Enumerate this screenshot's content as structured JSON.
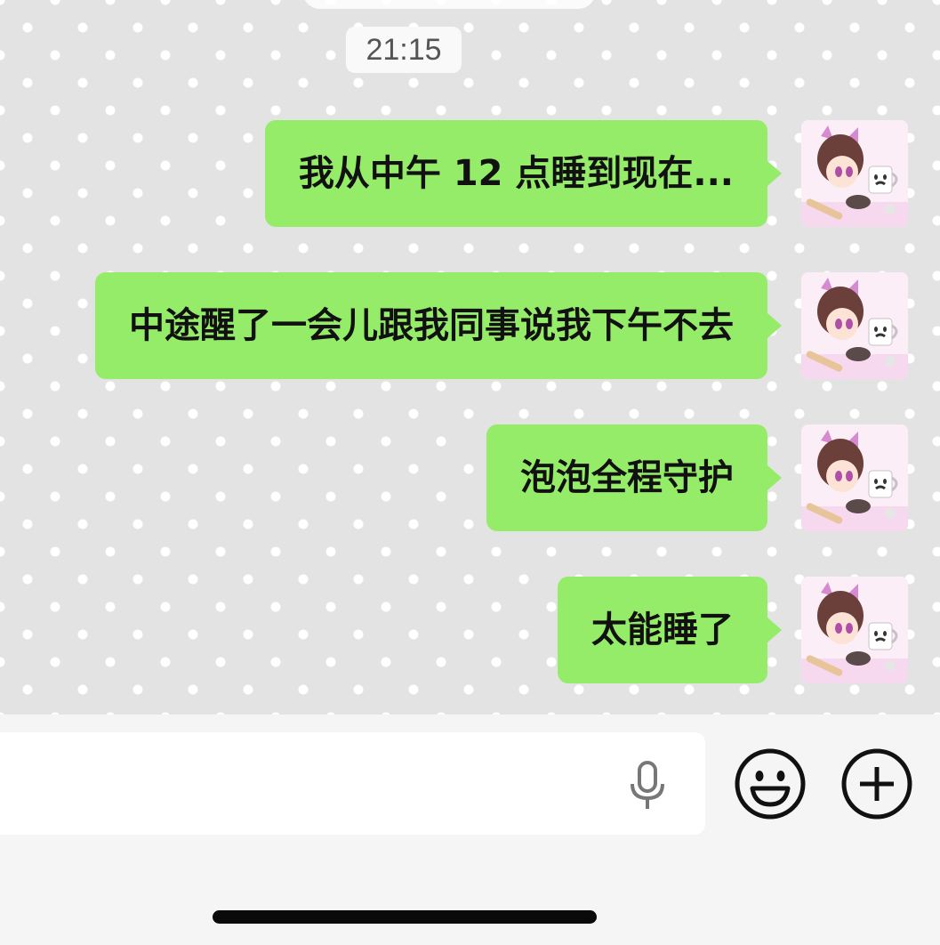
{
  "chat": {
    "timestamp": "21:15",
    "messages": [
      {
        "text": "我从中午 12 点睡到现在..."
      },
      {
        "text": "中途醒了一会儿跟我同事说我下午不去"
      },
      {
        "text": "泡泡全程守护"
      },
      {
        "text": "太能睡了"
      }
    ]
  },
  "input_bar": {
    "icons": [
      "microphone-icon",
      "emoji-icon",
      "plus-icon"
    ]
  },
  "colors": {
    "bubble": "#95ec69",
    "chat_background": "#e3e3e3",
    "input_bar_background": "#f5f5f5"
  }
}
